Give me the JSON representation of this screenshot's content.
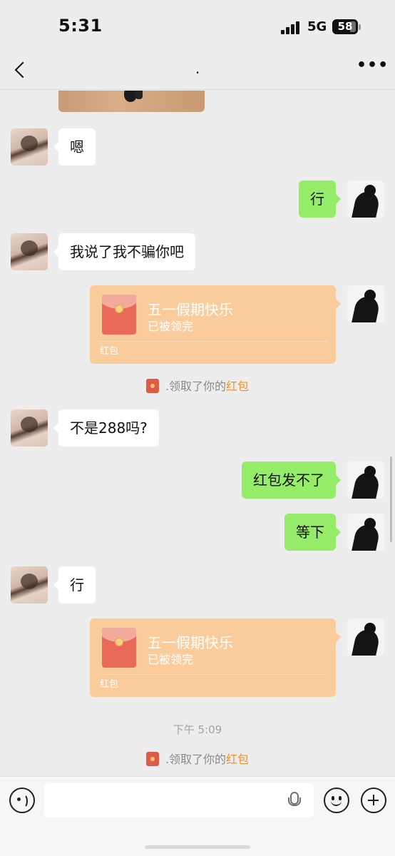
{
  "status_bar": {
    "time": "5:31",
    "network": "5G",
    "battery": "58"
  },
  "nav": {
    "title": ".",
    "more": "•••"
  },
  "messages": [
    {
      "side": "left",
      "type": "text",
      "text": "嗯"
    },
    {
      "side": "right",
      "type": "text",
      "text": "行"
    },
    {
      "side": "left",
      "type": "text",
      "text": "我说了我不骗你吧"
    },
    {
      "side": "right",
      "type": "red_packet",
      "title": "五一假期快乐",
      "status": "已被领完",
      "label": "红包"
    },
    {
      "type": "system",
      "prefix": ".领取了你的",
      "highlight": "红包"
    },
    {
      "side": "left",
      "type": "text",
      "text": "不是288吗?"
    },
    {
      "side": "right",
      "type": "text",
      "text": "红包发不了"
    },
    {
      "side": "right",
      "type": "text",
      "text": "等下"
    },
    {
      "side": "left",
      "type": "text",
      "text": "行"
    },
    {
      "side": "right",
      "type": "red_packet",
      "title": "五一假期快乐",
      "status": "已被领完",
      "label": "红包"
    },
    {
      "type": "time",
      "text": "下午 5:09"
    },
    {
      "type": "system",
      "prefix": ".领取了你的",
      "highlight": "红包"
    }
  ],
  "colors": {
    "sent_bubble": "#95ec69",
    "received_bubble": "#ffffff",
    "red_packet": "#fbcc9b",
    "highlight": "#f0902f",
    "background": "#ededed"
  },
  "input_bar": {
    "placeholder": "",
    "icons": [
      "voice-icon",
      "microphone-icon",
      "emoji-icon",
      "plus-icon"
    ]
  }
}
